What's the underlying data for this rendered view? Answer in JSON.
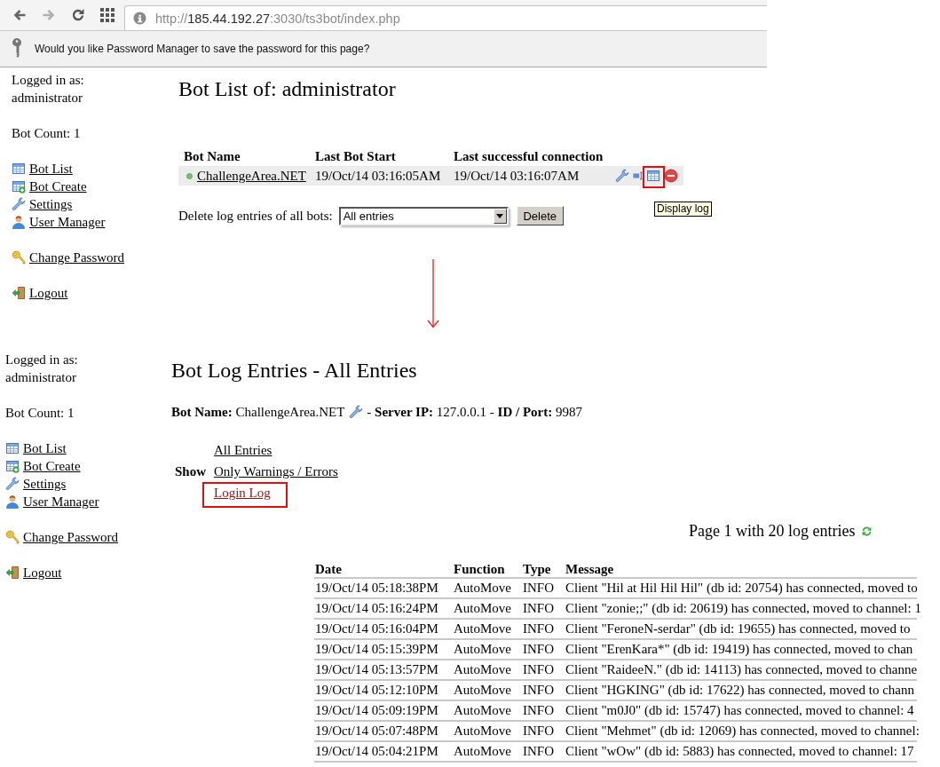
{
  "browser": {
    "url": {
      "scheme": "http://",
      "host": "185.44.192.27",
      "path": ":3030/ts3bot/index.php"
    },
    "password_prompt": "Would you like Password Manager to save the password for this page?"
  },
  "bot_list_page": {
    "sidebar": {
      "logged_in_label": "Logged in as:",
      "username": "administrator",
      "bot_count": "Bot Count: 1",
      "nav_groups": [
        {
          "items": [
            {
              "kind": "bot-list",
              "label": "Bot List"
            },
            {
              "kind": "bot-create",
              "label": "Bot Create"
            },
            {
              "kind": "settings",
              "label": "Settings"
            },
            {
              "kind": "user-manager",
              "label": "User Manager"
            }
          ]
        },
        {
          "items": [
            {
              "kind": "change-password",
              "label": "Change Password"
            }
          ]
        },
        {
          "items": [
            {
              "kind": "logout",
              "label": "Logout"
            }
          ]
        }
      ]
    },
    "title": "Bot List of: administrator",
    "bot_table": {
      "columns": [
        "Bot Name",
        "Last Bot Start",
        "Last successful connection"
      ],
      "rows": [
        {
          "running": true,
          "name": "ChallengeArea.NET",
          "last_start": "19/Oct/14 03:16:05AM",
          "last_connection": "19/Oct/14 03:16:07AM",
          "actions": [
            {
              "kind": "settings",
              "highlighted": false
            },
            {
              "kind": "rename",
              "highlighted": false
            },
            {
              "kind": "log",
              "highlighted": true,
              "tooltip": "Display log"
            },
            {
              "kind": "delete",
              "highlighted": false
            }
          ]
        }
      ]
    },
    "delete_form": {
      "label": "Delete log entries of all bots:",
      "select_value": "All entries",
      "button": "Delete"
    }
  },
  "log_page": {
    "sidebar": {
      "logged_in_label": "Logged in as:",
      "username": "administrator",
      "bot_count": "Bot Count: 1",
      "nav_groups": [
        {
          "items": [
            {
              "kind": "bot-list",
              "label": "Bot List"
            },
            {
              "kind": "bot-create",
              "label": "Bot Create"
            },
            {
              "kind": "settings",
              "label": "Settings"
            },
            {
              "kind": "user-manager",
              "label": "User Manager"
            }
          ]
        },
        {
          "items": [
            {
              "kind": "change-password",
              "label": "Change Password"
            }
          ]
        },
        {
          "items": [
            {
              "kind": "logout",
              "label": "Logout"
            }
          ]
        }
      ]
    },
    "title": "Bot Log Entries - All Entries",
    "bot_info": {
      "name_text": "**Bot Name:** ChallengeArea.NET",
      "server_text": "- **Server IP:** 127.0.0.1 - **ID / Port:** 9987"
    },
    "filter": {
      "label": "Show",
      "options": [
        {
          "label": "All Entries",
          "hovered": false,
          "highlighted": false
        },
        {
          "label": "Only Warnings / Errors",
          "hovered": false,
          "highlighted": false
        },
        {
          "label": "Login Log",
          "hovered": true,
          "highlighted": true
        }
      ]
    },
    "page_info": "Page 1 with 20 log entries",
    "log_table": {
      "columns": [
        "Date",
        "Function",
        "Type",
        "Message"
      ],
      "rows": [
        {
          "date": "19/Oct/14 05:18:38PM",
          "function": "AutoMove",
          "type": "INFO",
          "message": "Client \"Hil at Hil Hil Hil\" (db id: 20754) has connected, moved to"
        },
        {
          "date": "19/Oct/14 05:16:24PM",
          "function": "AutoMove",
          "type": "INFO",
          "message": "Client \"zonie;;\" (db id: 20619) has connected, moved to channel: 1"
        },
        {
          "date": "19/Oct/14 05:16:04PM",
          "function": "AutoMove",
          "type": "INFO",
          "message": "Client \"FeroneN-serdar\" (db id: 19655) has connected, moved to"
        },
        {
          "date": "19/Oct/14 05:15:39PM",
          "function": "AutoMove",
          "type": "INFO",
          "message": "Client \"ErenKara*\" (db id: 19419) has connected, moved to chan"
        },
        {
          "date": "19/Oct/14 05:13:57PM",
          "function": "AutoMove",
          "type": "INFO",
          "message": "Client \"RaideeN.\" (db id: 14113) has connected, moved to channe"
        },
        {
          "date": "19/Oct/14 05:12:10PM",
          "function": "AutoMove",
          "type": "INFO",
          "message": "Client \"HGKING\" (db id: 17622) has connected, moved to chann"
        },
        {
          "date": "19/Oct/14 05:09:19PM",
          "function": "AutoMove",
          "type": "INFO",
          "message": "Client \"m0J0\" (db id: 15747) has connected, moved to channel: 4"
        },
        {
          "date": "19/Oct/14 05:07:48PM",
          "function": "AutoMove",
          "type": "INFO",
          "message": "Client \"Mehmet\" (db id: 12069) has connected, moved to channel:"
        },
        {
          "date": "19/Oct/14 05:04:21PM",
          "function": "AutoMove",
          "type": "INFO",
          "message": "Client \"wOw\" (db id: 5883) has connected, moved to channel: 17"
        }
      ]
    }
  }
}
